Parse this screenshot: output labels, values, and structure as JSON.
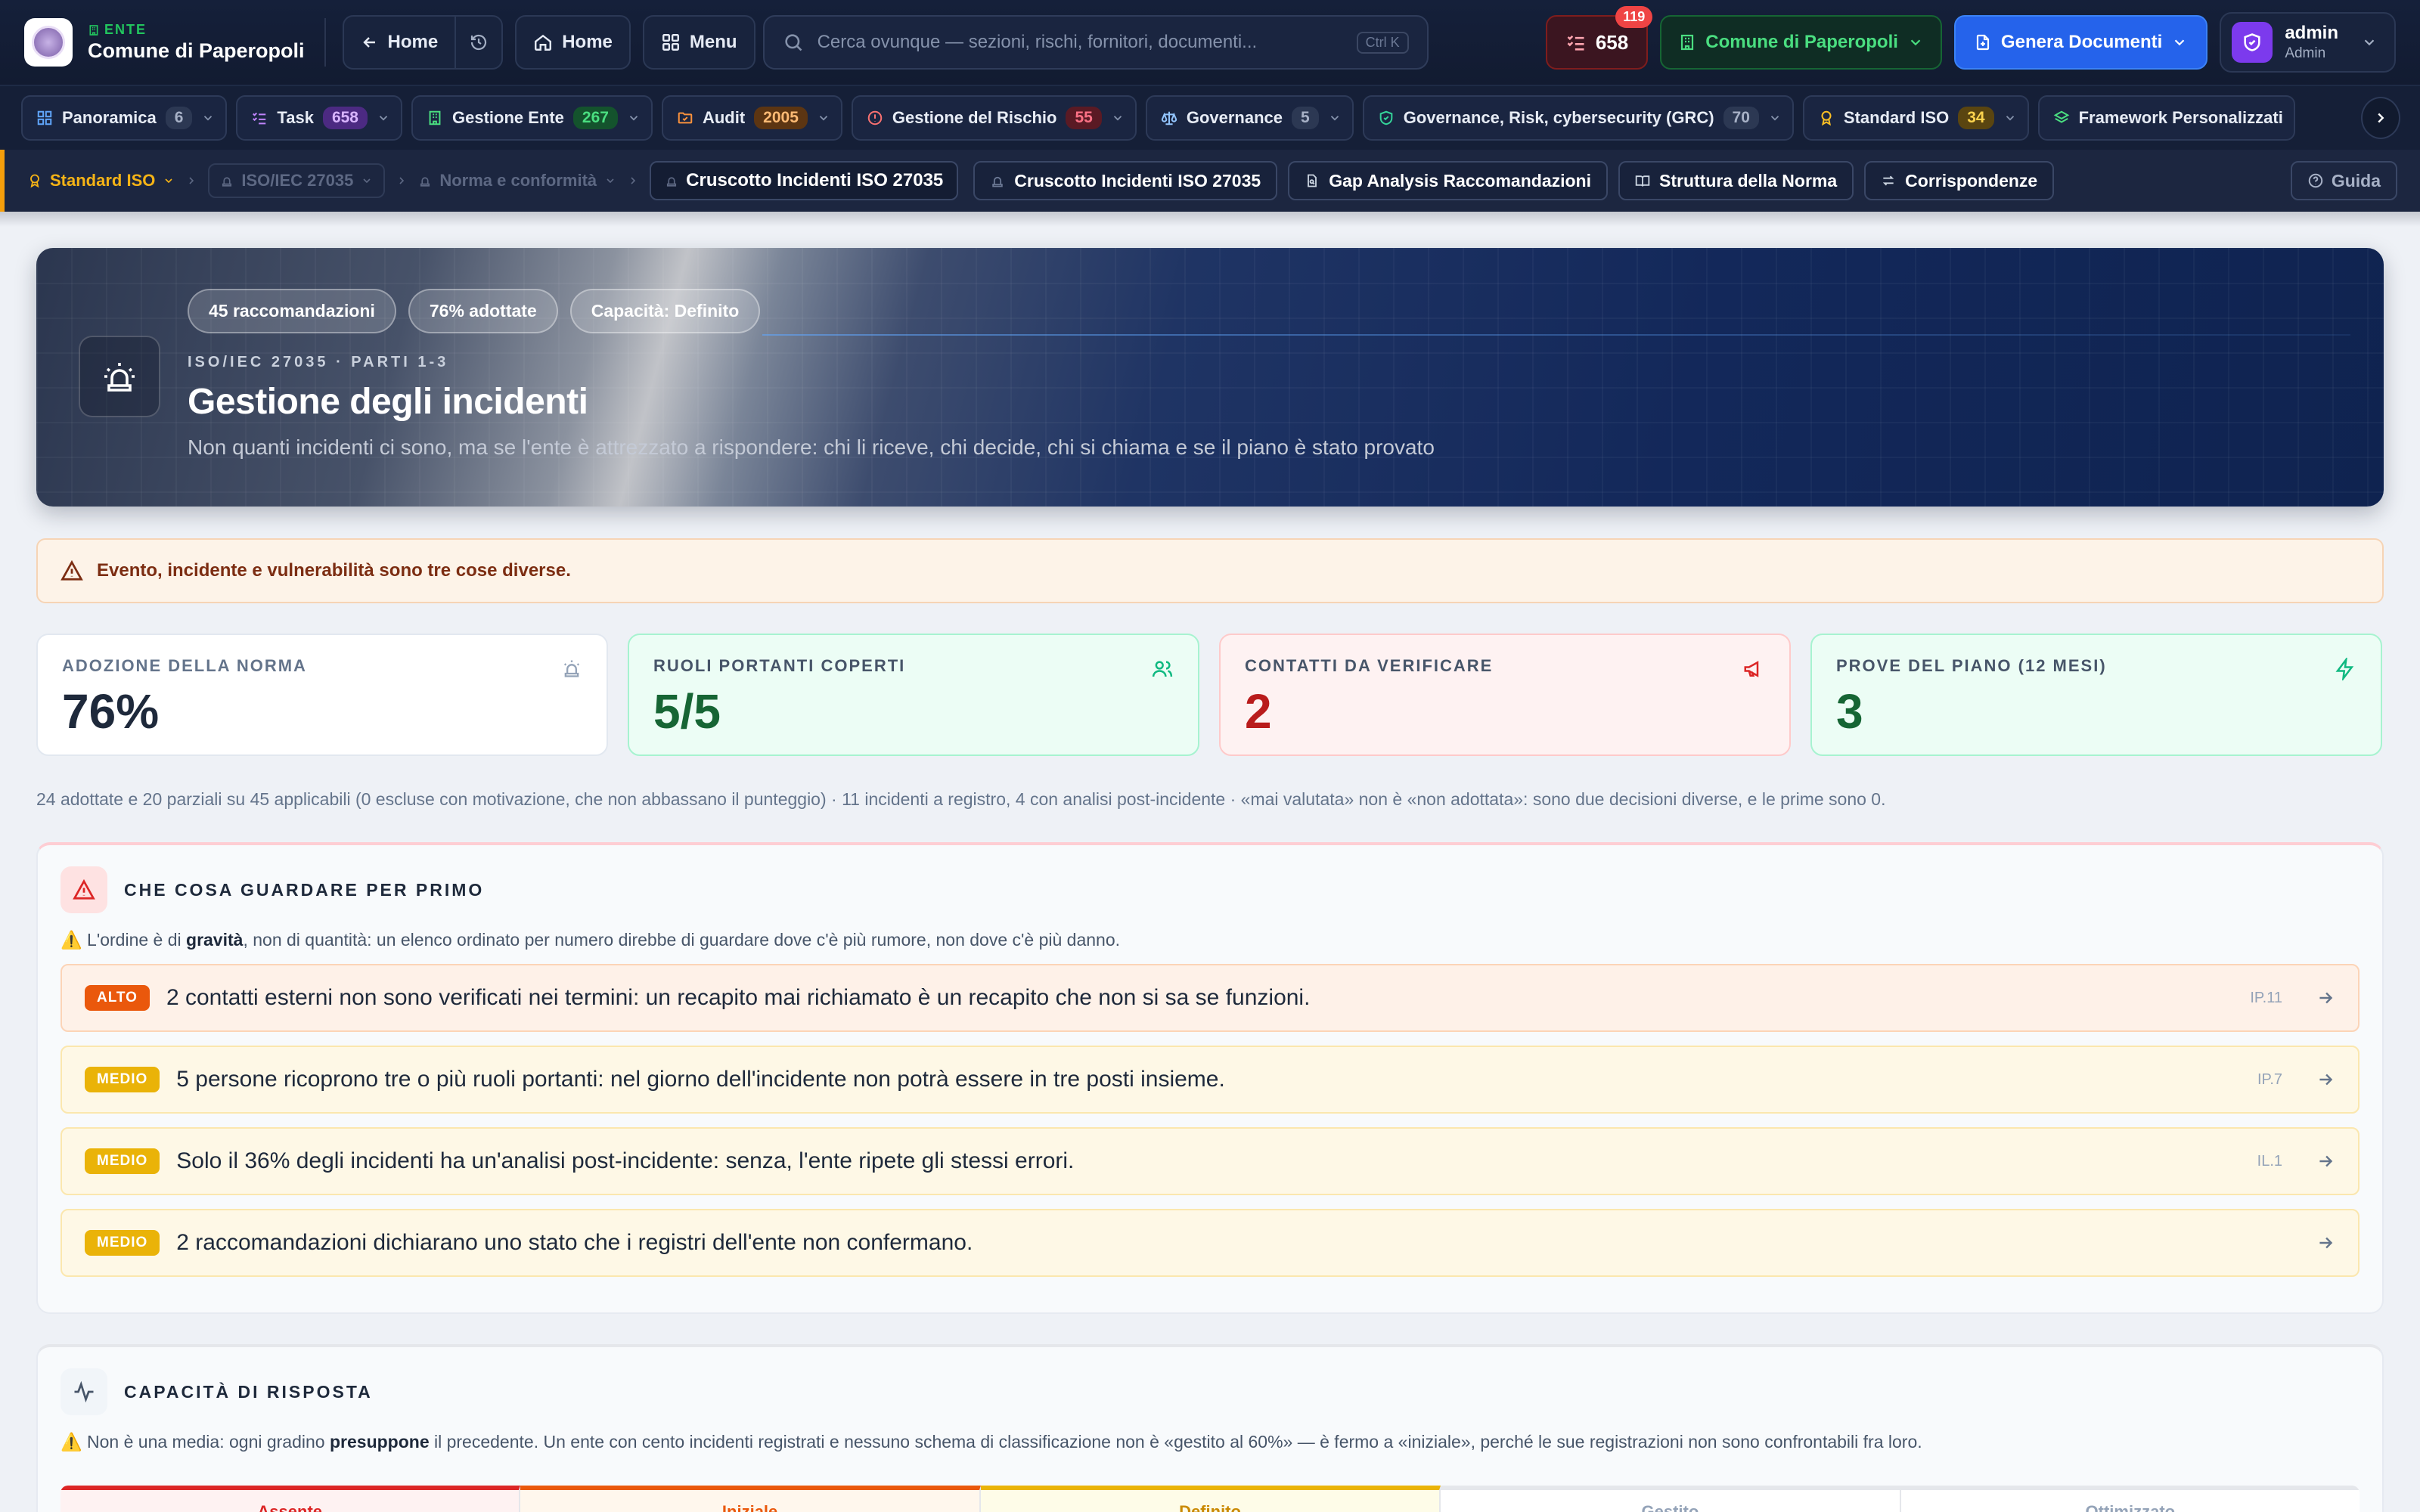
{
  "topbar": {
    "entity_kicker": "ENTE",
    "entity_name": "Comune di Paperopoli",
    "back_home_label": "Home",
    "home_label": "Home",
    "menu_label": "Menu",
    "search_placeholder": "Cerca ovunque — sezioni, rischi, fornitori, documenti...",
    "search_shortcut": "Ctrl K",
    "tasks_count": "658",
    "tasks_badge": "119",
    "entity_selector": "Comune di Paperopoli",
    "generate_label": "Genera Documenti",
    "user_name": "admin",
    "user_role": "Admin"
  },
  "nav": {
    "items": [
      {
        "label": "Panoramica",
        "count": "6"
      },
      {
        "label": "Task",
        "count": "658"
      },
      {
        "label": "Gestione Ente",
        "count": "267"
      },
      {
        "label": "Audit",
        "count": "2005"
      },
      {
        "label": "Gestione del Rischio",
        "count": "55"
      },
      {
        "label": "Governance",
        "count": "5"
      },
      {
        "label": "Governance, Risk, cybersecurity (GRC)",
        "count": "70"
      },
      {
        "label": "Standard ISO",
        "count": "34"
      },
      {
        "label": "Framework Personalizzati",
        "count": ""
      }
    ]
  },
  "breadcrumb": {
    "root": "Standard ISO",
    "level1": "ISO/IEC 27035",
    "level2": "Norma e conformità",
    "current": "Cruscotto Incidenti ISO 27035",
    "tabs": [
      "Cruscotto Incidenti ISO 27035",
      "Gap Analysis Raccomandazioni",
      "Struttura della Norma",
      "Corrispondenze"
    ],
    "guide_label": "Guida"
  },
  "hero": {
    "pills": [
      "45 raccomandazioni",
      "76% adottate",
      "Capacità: Definito"
    ],
    "kicker": "ISO/IEC 27035 · PARTI 1-3",
    "title": "Gestione degli incidenti",
    "subtitle": "Non quanti incidenti ci sono, ma se l'ente è attrezzato a rispondere: chi li riceve, chi decide, chi si chiama e se il piano è stato provato"
  },
  "warning": {
    "text": "Evento, incidente e vulnerabilità sono tre cose diverse."
  },
  "stats": [
    {
      "label": "ADOZIONE DELLA NORMA",
      "value": "76%",
      "icon": "siren-icon"
    },
    {
      "label": "RUOLI PORTANTI COPERTI",
      "value": "5/5",
      "icon": "users-icon"
    },
    {
      "label": "CONTATTI DA VERIFICARE",
      "value": "2",
      "icon": "megaphone-icon"
    },
    {
      "label": "PROVE DEL PIANO (12 MESI)",
      "value": "3",
      "icon": "lightning-icon"
    }
  ],
  "summary": "24 adottate e 20 parziali su 45 applicabili (0 escluse con motivazione, che non abbassano il punteggio) · 11 incidenti a registro, 4 con analisi post-incidente · «mai valutata» non è «non adottata»: sono due decisioni diverse, e le prime sono 0.",
  "priorities": {
    "title": "CHE COSA GUARDARE PER PRIMO",
    "note_prefix": "⚠️ L'ordine è di ",
    "note_bold": "gravità",
    "note_suffix": ", non di quantità: un elenco ordinato per numero direbbe di guardare dove c'è più rumore, non dove c'è più danno.",
    "items": [
      {
        "severity": "ALTO",
        "text": "2 contatti esterni non sono verificati nei termini: un recapito mai richiamato è un recapito che non si sa se funzioni.",
        "ref": "IP.11"
      },
      {
        "severity": "MEDIO",
        "text": "5 persone ricoprono tre o più ruoli portanti: nel giorno dell'incidente non potrà essere in tre posti insieme.",
        "ref": "IP.7"
      },
      {
        "severity": "MEDIO",
        "text": "Solo il 36% degli incidenti ha un'analisi post-incidente: senza, l'ente ripete gli stessi errori.",
        "ref": "IL.1"
      },
      {
        "severity": "MEDIO",
        "text": "2 raccomandazioni dichiarano uno stato che i registri dell'ente non confermano.",
        "ref": ""
      }
    ]
  },
  "capacity": {
    "title": "CAPACITÀ DI RISPOSTA",
    "note_prefix": "⚠️ Non è una media: ogni gradino ",
    "note_bold": "presuppone",
    "note_suffix": " il precedente. Un ente con cento incidenti registrati e nessuno schema di classificazione non è «gestito al 60%» — è fermo a «iniziale», perché le sue registrazioni non sono confrontabili fra loro.",
    "levels": [
      "Assente",
      "Iniziale",
      "Definito",
      "Gestito",
      "Ottimizzato"
    ]
  },
  "colors": {
    "accent": "#2563eb",
    "alto": "#ea580c",
    "medio": "#eab308",
    "success": "#15803d",
    "danger": "#b91c1c"
  }
}
